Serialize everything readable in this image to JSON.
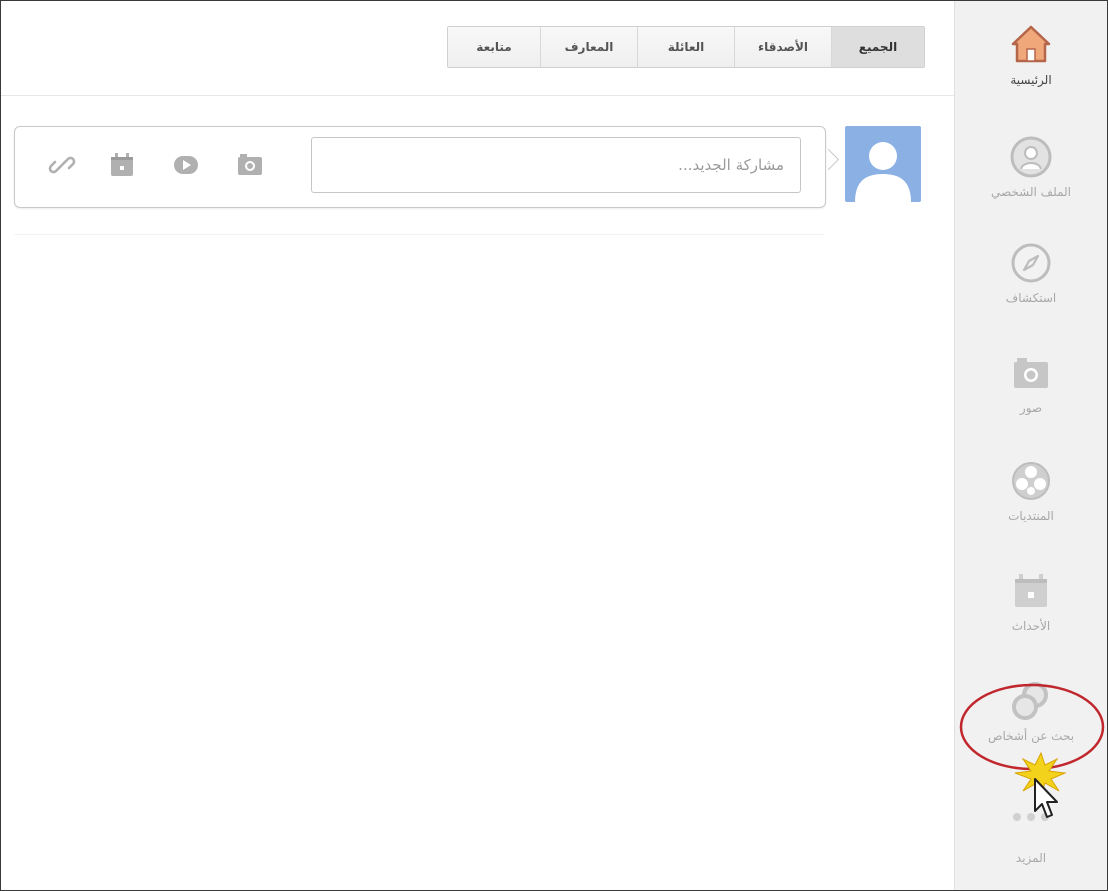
{
  "tabs": [
    {
      "label": "متابعة"
    },
    {
      "label": "المعارف"
    },
    {
      "label": "العائلة"
    },
    {
      "label": "الأصدقاء"
    },
    {
      "label": "الجميع"
    }
  ],
  "share": {
    "placeholder": "مشاركة الجديد..."
  },
  "sidebar": {
    "items": [
      {
        "label": "الرئيسية",
        "icon": "home-icon"
      },
      {
        "label": "الملف الشخصي",
        "icon": "profile-icon"
      },
      {
        "label": "استكشاف",
        "icon": "compass-icon"
      },
      {
        "label": "صور",
        "icon": "camera-icon"
      },
      {
        "label": "المنتديات",
        "icon": "forums-icon"
      },
      {
        "label": "الأحداث",
        "icon": "calendar-icon"
      },
      {
        "label": "بحث عن أشخاص",
        "icon": "find-people-icon"
      },
      {
        "label": "المزيد",
        "icon": "more-dots-icon"
      }
    ]
  },
  "colors": {
    "accent_annotation": "#c0282e",
    "avatar_bg": "#8ab0e4",
    "sidebar_bg": "#f1f1f1"
  }
}
